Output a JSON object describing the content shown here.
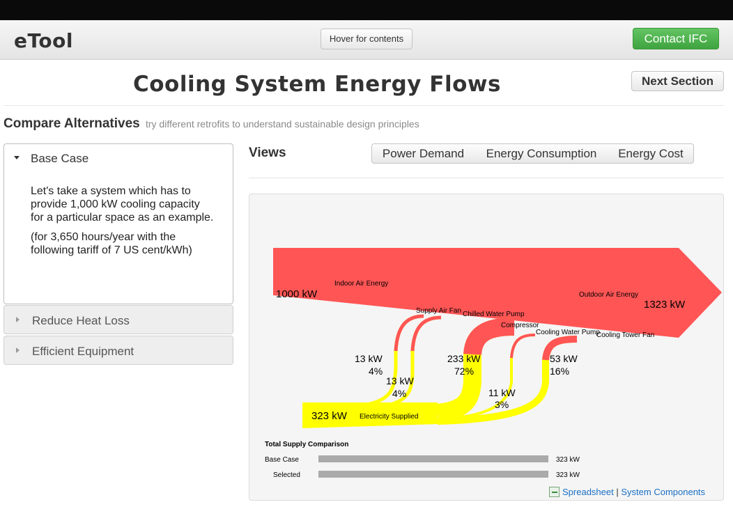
{
  "navbar": {
    "logo": "eTool",
    "hover_button": "Hover for contents",
    "contact_button": "Contact IFC"
  },
  "page": {
    "title": "Cooling System Energy Flows",
    "next_button": "Next Section"
  },
  "compare": {
    "heading": "Compare Alternatives",
    "subheading": "try different retrofits to understand sustainable design principles"
  },
  "accordion": {
    "open": {
      "label": "Base Case",
      "paragraph1": "Let's take a system which has to provide 1,000 kW cooling capacity for a particular space as an example.",
      "paragraph2": "(for 3,650 hours/year with the following tariff of 7 US cent/kWh)"
    },
    "closed": [
      {
        "label": "Reduce Heat Loss"
      },
      {
        "label": "Efficient Equipment"
      }
    ]
  },
  "views": {
    "label": "Views",
    "tabs": [
      {
        "label": "Power Demand"
      },
      {
        "label": "Energy Consumption"
      },
      {
        "label": "Energy Cost"
      }
    ]
  },
  "sankey": {
    "colors": {
      "heat": "#ff5555",
      "electric": "#ffff00"
    },
    "indoor_value": "1000 kW",
    "indoor_label": "Indoor Air Energy",
    "outdoor_value": "1323 kW",
    "outdoor_label": "Outdoor Air Energy",
    "electric_value": "323 kW",
    "electric_label": "Electricity Supplied",
    "components": [
      {
        "label": "Supply Air Fan",
        "kw": "13 kW",
        "pct": "4%"
      },
      {
        "label": "Chilled Water Pump",
        "kw": "13 kW",
        "pct": "4%"
      },
      {
        "label": "Compressor",
        "kw": "233 kW",
        "pct": "72%"
      },
      {
        "label": "Cooling Water Pump",
        "kw": "11 kW",
        "pct": "3%"
      },
      {
        "label": "Cooling Tower Fan",
        "kw": "53 kW",
        "pct": "16%"
      }
    ]
  },
  "comparison": {
    "title": "Total Supply Comparison",
    "rows": [
      {
        "label": "Base Case",
        "value": "323 kW",
        "fraction": 1.0
      },
      {
        "label": "Selected",
        "value": "323 kW",
        "fraction": 1.0
      }
    ]
  },
  "links": {
    "spreadsheet": "Spreadsheet",
    "separator": "|",
    "components": "System Components"
  }
}
